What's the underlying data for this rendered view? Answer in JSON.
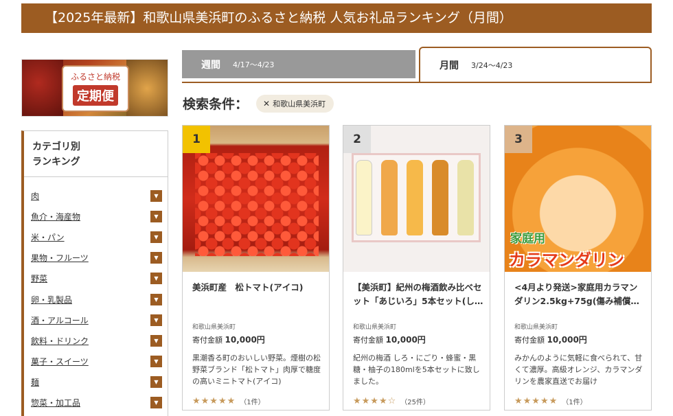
{
  "header": {
    "title": "【2025年最新】和歌山県美浜町のふるさと納税 人気お礼品ランキング（月間）"
  },
  "banner": {
    "line1": "ふるさと納税",
    "line2": "定期便"
  },
  "categories": {
    "title_line1": "カテゴリ別",
    "title_line2": "ランキング",
    "items": [
      {
        "label": "肉"
      },
      {
        "label": "魚介・海産物"
      },
      {
        "label": "米・パン"
      },
      {
        "label": "果物・フルーツ"
      },
      {
        "label": "野菜"
      },
      {
        "label": "卵・乳製品"
      },
      {
        "label": "酒・アルコール"
      },
      {
        "label": "飲料・ドリンク"
      },
      {
        "label": "菓子・スイーツ"
      },
      {
        "label": "麺"
      },
      {
        "label": "惣菜・加工品"
      }
    ]
  },
  "tabs": {
    "weekly": {
      "label": "週間",
      "dates": "4/17〜4/23"
    },
    "monthly": {
      "label": "月間",
      "dates": "3/24〜4/23"
    }
  },
  "search": {
    "label": "検索条件：",
    "chip": "和歌山県美浜町",
    "chip_icon": "close-icon"
  },
  "products": [
    {
      "rank": "1",
      "title": "美浜町産　松トマト(アイコ)",
      "municipality": "和歌山県美浜町",
      "price_label": "寄付金額",
      "price": "10,000円",
      "description": "黒潮香る町のおいしい野菜。煙樹の松野菜ブランド「松トマト」肉厚で糖度の高いミニトマト(アイコ)",
      "stars": "★★★★★",
      "rating": 5,
      "reviews": "（1件）"
    },
    {
      "rank": "2",
      "title": "【美浜町】紀州の梅酒飲み比べセット「あじいろ」5本セット(し…",
      "municipality": "和歌山県美浜町",
      "price_label": "寄付金額",
      "price": "10,000円",
      "description": "紀州の梅酒 しろ・にごり・蜂蜜・黒糖・柚子の180mlを5本セットに致しました。",
      "stars": "★★★★☆",
      "rating": 4.5,
      "reviews": "（25件）"
    },
    {
      "rank": "3",
      "title": "<4月より発送>家庭用カラマンダリン2.5kg+75g(傷み補償…",
      "municipality": "和歌山県美浜町",
      "price_label": "寄付金額",
      "price": "10,000円",
      "description": "みかんのように気軽に食べられて、甘くて濃厚。高級オレンジ、カラマンダリンを農家直送でお届け",
      "stars": "★★★★★",
      "rating": 5,
      "reviews": "（1件）",
      "image_caption1": "家庭用",
      "image_caption2": "カラマンダリン"
    }
  ],
  "colors": {
    "brand": "#9c5c22",
    "rank1": "#f2c200",
    "rank2": "#e0e0e0",
    "rank3": "#ddb48a",
    "star": "#c79a5c"
  }
}
